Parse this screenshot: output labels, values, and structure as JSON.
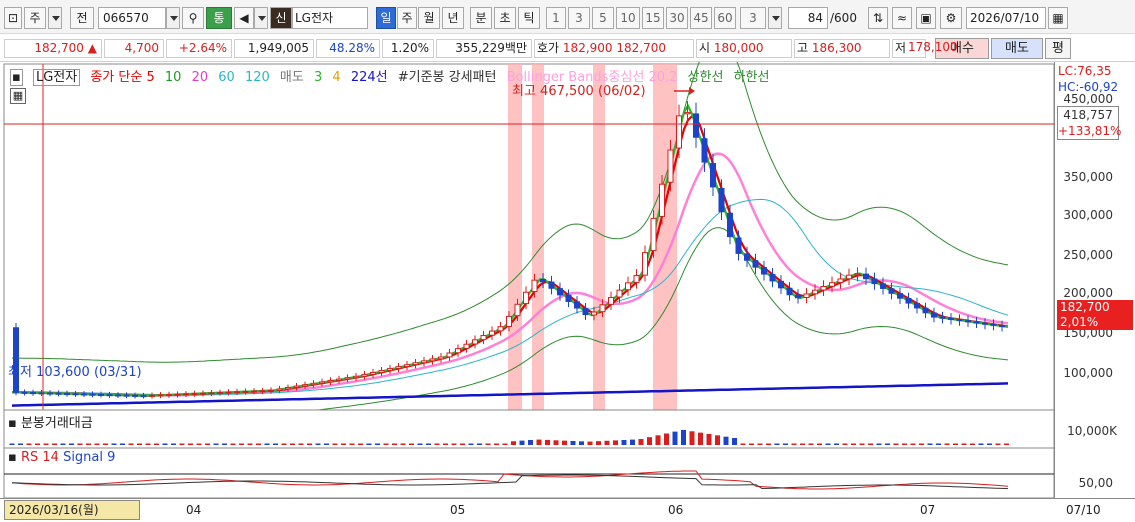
{
  "toolbar": {
    "ju_label": "주",
    "jeon_label": "전",
    "code": "066570",
    "tong_label": "통",
    "shin_label": "신",
    "stock_name": "LG전자",
    "periods": [
      "일",
      "주",
      "월",
      "년",
      "분",
      "초",
      "틱"
    ],
    "intervals": [
      "1",
      "3",
      "5",
      "10",
      "15",
      "30",
      "45",
      "60"
    ],
    "interval_selected": "3",
    "count": "84",
    "count_total": "/600",
    "date": "2026/07/10"
  },
  "quote": {
    "price": "182,700",
    "change": "4,700",
    "change_pct": "+2.64%",
    "volume": "1,949,005",
    "volume_ratio": "48.28%",
    "turnover_pct": "1.20%",
    "amount": "355,229백만",
    "hoga_label": "호가",
    "ask": "182,900",
    "bid": "182,700",
    "open_label": "시",
    "open": "180,000",
    "high_label": "고",
    "high": "186,300",
    "low_label": "저",
    "low": "178,100",
    "buy_label": "매수",
    "sell_label": "매도",
    "pyeong_label": "평"
  },
  "legend": {
    "name": "LG전자",
    "close_ma": "종가 단순 5",
    "ma10": "10",
    "ma20": "20",
    "ma60": "60",
    "ma120": "120",
    "sell_ind": "매도",
    "s3": "3",
    "s4": "4",
    "line224": "224선",
    "pattern": "#기준봉 강세패턴",
    "bollinger": "Bollinger Bands중심선 20,2",
    "upper": "상한선",
    "lower": "하한선"
  },
  "annotations": {
    "high_text": "최고 467,500 (06/02)",
    "low_text": "최저 103,600 (03/31)"
  },
  "right_panel": {
    "lc": "LC:76,35",
    "hc": "HC:-60,92",
    "cross_price": "418,757",
    "cross_pct": "+133,81%",
    "last_price": "182,700",
    "last_pct": "2,01%",
    "yticks": [
      "450,000",
      "400,000",
      "350,000",
      "300,000",
      "250,000",
      "200,000",
      "150,000",
      "100,000"
    ],
    "vol_tick": "10,000K",
    "rsi_tick": "50,00"
  },
  "panels": {
    "volume_label": "분봉거래대금",
    "rsi_label": "RS 14",
    "signal_label": "Signal 9"
  },
  "datebar": {
    "cursor_date": "2026/03/16(월)",
    "ticks": [
      "04",
      "05",
      "06",
      "07"
    ],
    "right_date": "07/10"
  },
  "colors": {
    "up": "#d81e1e",
    "down": "#1d44c8",
    "ma5": "#e60000",
    "ma10": "#1a9e1a",
    "ma20": "#e040c0",
    "ma60": "#29b6c8",
    "ma120": "#1515c8",
    "bollinger": "#ff80d8",
    "band": "#2e8b2e",
    "highlight": "#ffb3b3",
    "date_box": "#f5e7a5"
  },
  "chart_data": {
    "type": "candlestick",
    "ylim": [
      90000,
      480000
    ],
    "high_marker": 467500,
    "low_marker": 103600,
    "close_series": [
      {
        "d": "03/16",
        "v": 110000
      },
      {
        "d": "03/31",
        "v": 106000
      },
      {
        "d": "04/15",
        "v": 112000
      },
      {
        "d": "04/25",
        "v": 128000
      },
      {
        "d": "05/05",
        "v": 150000
      },
      {
        "d": "05/12",
        "v": 185000
      },
      {
        "d": "05/16",
        "v": 240000
      },
      {
        "d": "05/22",
        "v": 195000
      },
      {
        "d": "05/28",
        "v": 245000
      },
      {
        "d": "06/02",
        "v": 440000
      },
      {
        "d": "06/08",
        "v": 270000
      },
      {
        "d": "06/15",
        "v": 215000
      },
      {
        "d": "06/22",
        "v": 245000
      },
      {
        "d": "07/01",
        "v": 195000
      },
      {
        "d": "07/10",
        "v": 182700
      }
    ]
  }
}
